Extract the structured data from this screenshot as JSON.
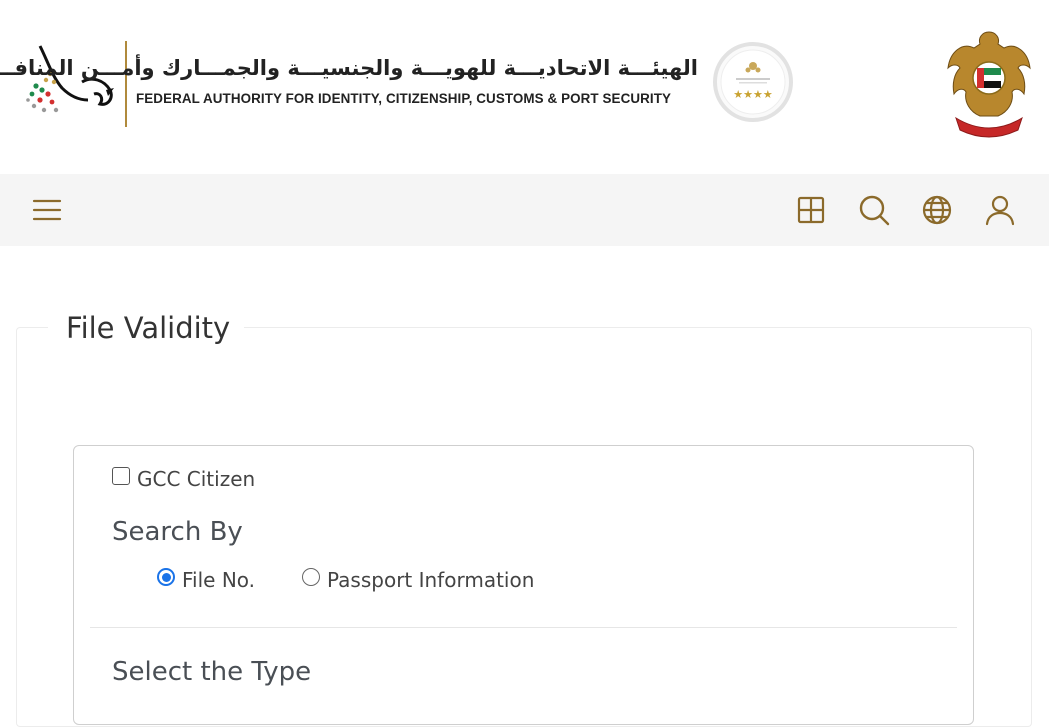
{
  "header": {
    "org_name_ar": "الهيئـــة الاتحاديـــة للهويـــة والجنسيـــة والجمـــارك وأمـــن المنافـــذ",
    "org_name_en": "FEDERAL AUTHORITY FOR IDENTITY, CITIZENSHIP, CUSTOMS & PORT SECURITY",
    "award_stars": "★★★★"
  },
  "navbar": {
    "icons": [
      "menu-icon",
      "apps-grid-icon",
      "search-icon",
      "globe-icon",
      "user-icon"
    ],
    "accent_color": "#8b6a2b"
  },
  "form": {
    "title": "File Validity",
    "gcc_checkbox_label": "GCC Citizen",
    "gcc_checked": false,
    "search_by_label": "Search By",
    "search_options": [
      {
        "label": "File No.",
        "selected": true
      },
      {
        "label": "Passport Information",
        "selected": false
      }
    ],
    "select_type_label": "Select the Type"
  },
  "colors": {
    "nav_bg": "#f5f5f5",
    "radio_selected": "#1a73e8",
    "gold": "#b08a3c"
  }
}
